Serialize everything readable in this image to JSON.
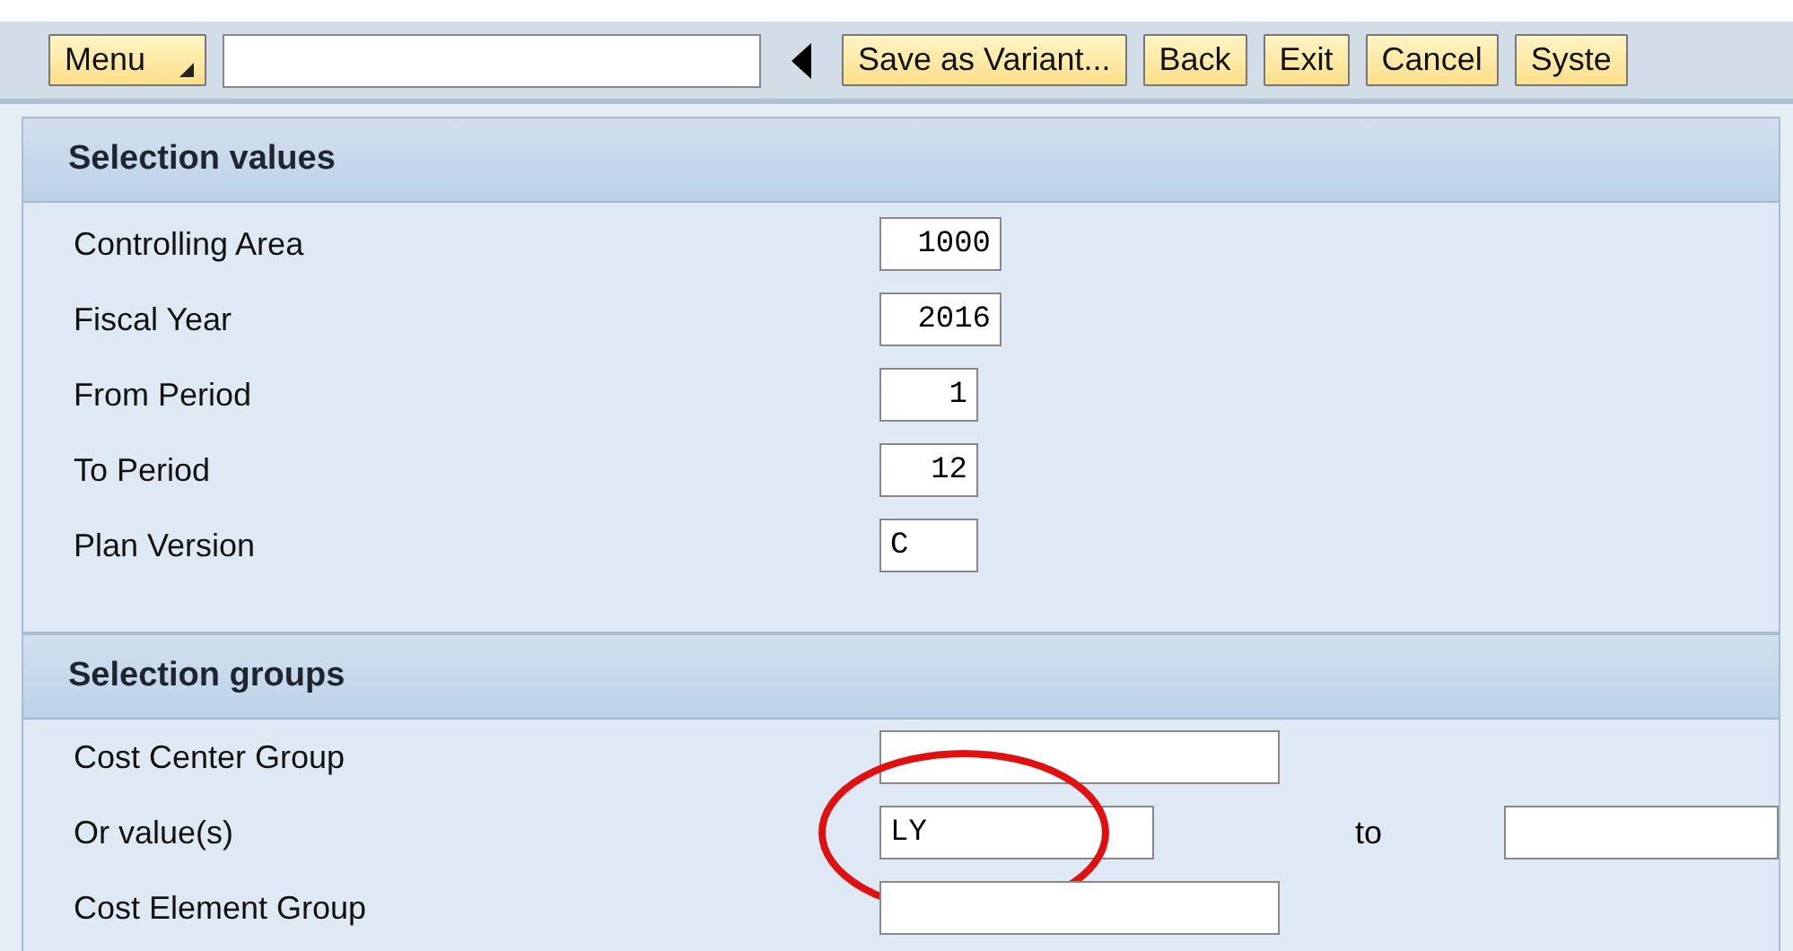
{
  "toolbar": {
    "menu_button": "Menu",
    "buttons": [
      "Save as Variant...",
      "Back",
      "Exit",
      "Cancel",
      "Syste"
    ]
  },
  "sections": [
    {
      "title": "Selection values",
      "rows": [
        {
          "label": "Controlling Area",
          "kind": "number",
          "value": "1000"
        },
        {
          "label": "Fiscal Year",
          "kind": "number",
          "value": "2016"
        },
        {
          "label": "From Period",
          "kind": "number",
          "value": "1"
        },
        {
          "label": "To Period",
          "kind": "number",
          "value": "12"
        },
        {
          "label": "Plan Version",
          "kind": "text",
          "value": "C"
        }
      ]
    },
    {
      "title": "Selection groups",
      "rows": [
        {
          "label": "Cost Center Group",
          "kind": "text"
        },
        {
          "label": "Or value(s)",
          "kind": "range",
          "value": "LY",
          "to_label": "to",
          "circled": true
        },
        {
          "label": "Cost Element Group",
          "kind": "text"
        }
      ]
    }
  ]
}
